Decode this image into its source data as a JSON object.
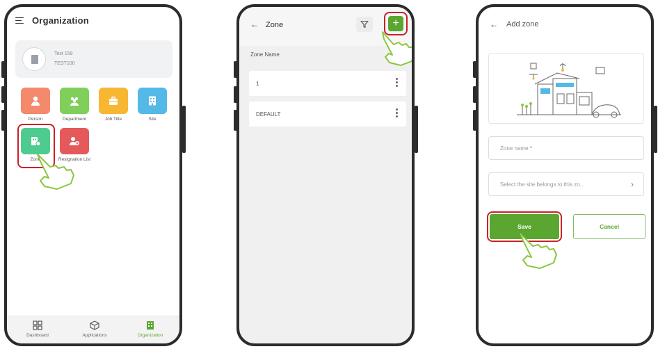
{
  "colors": {
    "brand_green": "#5aa630",
    "highlight_red": "#c8202b",
    "frame": "#2c2c2c"
  },
  "phone1": {
    "title": "Organization",
    "org": {
      "name": "Test 159",
      "code": "TEST100"
    },
    "tiles": [
      {
        "label": "Person",
        "icon": "person-icon",
        "color": "#f4896b"
      },
      {
        "label": "Department",
        "icon": "group-icon",
        "color": "#7fcf5a"
      },
      {
        "label": "Job Title",
        "icon": "briefcase-icon",
        "color": "#f7b733"
      },
      {
        "label": "Site",
        "icon": "building-icon",
        "color": "#54b9e6"
      },
      {
        "label": "Zone",
        "icon": "zone-icon",
        "color": "#4ecb8f"
      },
      {
        "label": "Resignation List",
        "icon": "user-remove-icon",
        "color": "#e6595b"
      }
    ],
    "nav": [
      {
        "label": "Dashboard",
        "icon": "grid-icon"
      },
      {
        "label": "Applications",
        "icon": "cube-icon"
      },
      {
        "label": "Organization",
        "icon": "building-icon",
        "active": true
      }
    ]
  },
  "phone2": {
    "title": "Zone",
    "filter_icon": "filter-icon",
    "add_label": "+",
    "column_header": "Zone Name",
    "rows": [
      {
        "name": "1"
      },
      {
        "name": "DEFAULT"
      }
    ]
  },
  "phone3": {
    "title": "Add zone",
    "zone_name_placeholder": "Zone name",
    "required_mark": "*",
    "site_placeholder": "Select the site belongs to this zo...",
    "save_label": "Save",
    "cancel_label": "Cancel"
  }
}
